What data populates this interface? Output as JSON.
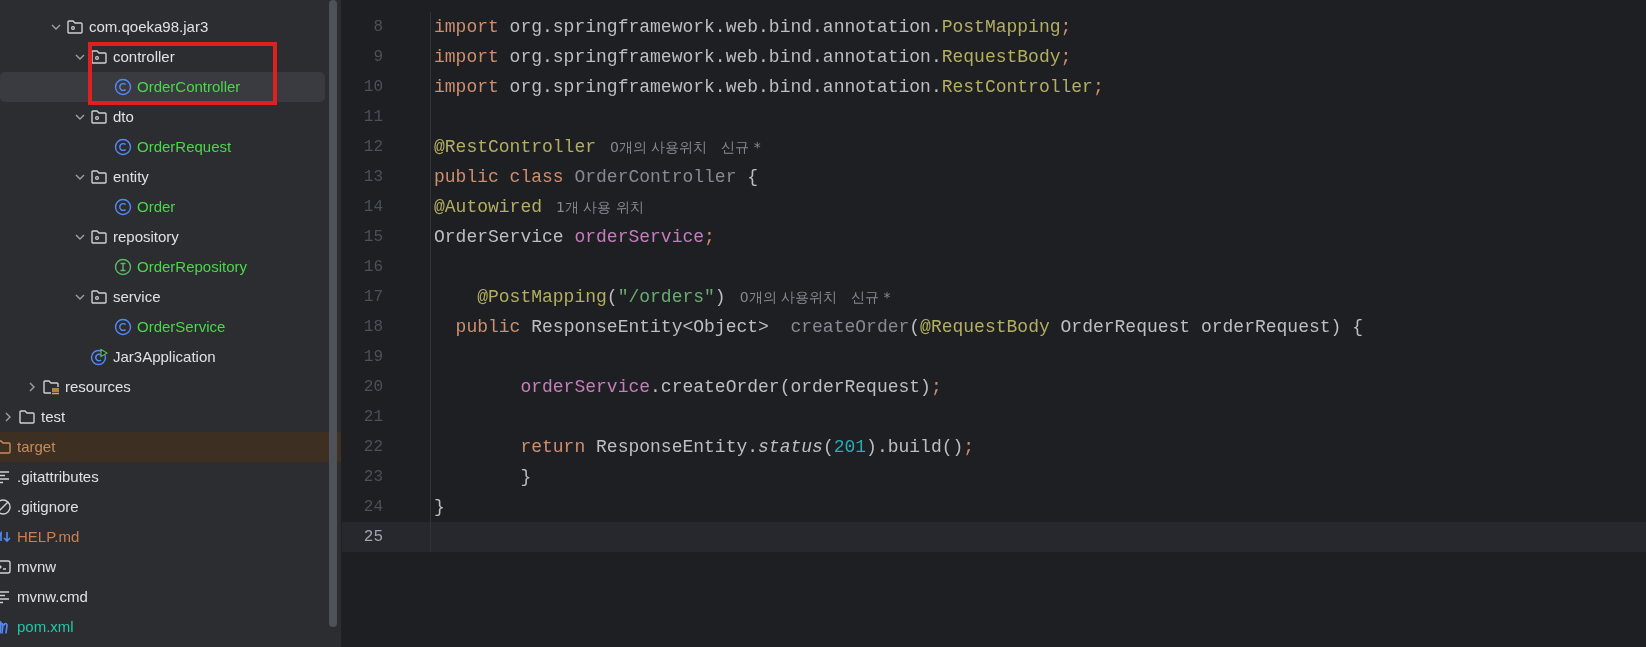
{
  "project_tree": {
    "items": [
      {
        "children": [
          {
            "children": [
              {
                "children": [
                  {
                    "label": "com.qoeka98.jar3",
                    "kind": "package",
                    "expanded": true,
                    "selected": false,
                    "excluded": false,
                    "color": "#dfe1e5",
                    "children": [
                      {
                        "label": "controller",
                        "kind": "package",
                        "expanded": true,
                        "selected": false,
                        "excluded": false,
                        "color": "#dfe1e5",
                        "children": [
                          {
                            "label": "OrderController",
                            "kind": "class",
                            "selected": true,
                            "excluded": false,
                            "color": "#4ad84a"
                          }
                        ]
                      },
                      {
                        "label": "dto",
                        "kind": "package",
                        "expanded": true,
                        "selected": false,
                        "excluded": false,
                        "color": "#dfe1e5",
                        "children": [
                          {
                            "label": "OrderRequest",
                            "kind": "class",
                            "selected": false,
                            "excluded": false,
                            "color": "#4ad84a"
                          }
                        ]
                      },
                      {
                        "label": "entity",
                        "kind": "package",
                        "expanded": true,
                        "selected": false,
                        "excluded": false,
                        "color": "#dfe1e5",
                        "children": [
                          {
                            "label": "Order",
                            "kind": "class",
                            "selected": false,
                            "excluded": false,
                            "color": "#4ad84a"
                          }
                        ]
                      },
                      {
                        "label": "repository",
                        "kind": "package",
                        "expanded": true,
                        "selected": false,
                        "excluded": false,
                        "color": "#dfe1e5",
                        "children": [
                          {
                            "label": "OrderRepository",
                            "kind": "interface",
                            "selected": false,
                            "excluded": false,
                            "color": "#4ad84a"
                          }
                        ]
                      },
                      {
                        "label": "service",
                        "kind": "package",
                        "expanded": true,
                        "selected": false,
                        "excluded": false,
                        "color": "#dfe1e5",
                        "children": [
                          {
                            "label": "OrderService",
                            "kind": "class",
                            "selected": false,
                            "excluded": false,
                            "color": "#4ad84a"
                          }
                        ]
                      },
                      {
                        "label": "Jar3Application",
                        "kind": "app-class",
                        "selected": false,
                        "excluded": false,
                        "color": "#dfe1e5"
                      }
                    ]
                  }
                ]
              },
              {
                "label": "resources",
                "kind": "resources-folder",
                "expanded": false,
                "selected": false,
                "excluded": false,
                "color": "#dfe1e5"
              }
            ]
          },
          {
            "label": "test",
            "kind": "folder",
            "expanded": false,
            "selected": false,
            "excluded": false,
            "color": "#dfe1e5"
          }
        ]
      },
      {
        "label": "target",
        "kind": "folder",
        "selected": false,
        "excluded": true,
        "color": "#c88a5c"
      },
      {
        "label": ".gitattributes",
        "kind": "text-file",
        "selected": false,
        "excluded": false,
        "color": "#dfe1e5"
      },
      {
        "label": ".gitignore",
        "kind": "ignore-file",
        "selected": false,
        "excluded": false,
        "color": "#dfe1e5"
      },
      {
        "label": "HELP.md",
        "kind": "markdown-file",
        "selected": false,
        "excluded": false,
        "color": "#cc7f4e"
      },
      {
        "label": "mvnw",
        "kind": "script-file",
        "selected": false,
        "excluded": false,
        "color": "#dfe1e5"
      },
      {
        "label": "mvnw.cmd",
        "kind": "text-file",
        "selected": false,
        "excluded": false,
        "color": "#dfe1e5"
      },
      {
        "label": "pom.xml",
        "kind": "maven-file",
        "selected": false,
        "excluded": false,
        "color": "#21c7a8"
      }
    ]
  },
  "editor": {
    "lines": [
      {
        "number": "8",
        "current": false,
        "tokens": [
          {
            "kind": "keyword",
            "text": "import"
          },
          {
            "kind": "plain",
            "text": " org.springframework.web.bind.annotation."
          },
          {
            "kind": "annotation",
            "text": "PostMapping"
          },
          {
            "kind": "punct",
            "text": ";"
          }
        ]
      },
      {
        "number": "9",
        "current": false,
        "tokens": [
          {
            "kind": "keyword",
            "text": "import"
          },
          {
            "kind": "plain",
            "text": " org.springframework.web.bind.annotation."
          },
          {
            "kind": "annotation",
            "text": "RequestBody"
          },
          {
            "kind": "punct",
            "text": ";"
          }
        ]
      },
      {
        "number": "10",
        "current": false,
        "tokens": [
          {
            "kind": "keyword",
            "text": "import"
          },
          {
            "kind": "plain",
            "text": " org.springframework.web.bind.annotation."
          },
          {
            "kind": "annotation",
            "text": "RestController"
          },
          {
            "kind": "punct",
            "text": ";"
          }
        ]
      },
      {
        "number": "11",
        "current": false
      },
      {
        "number": "12",
        "current": false,
        "tokens": [
          {
            "kind": "annotation",
            "text": "@RestController"
          }
        ],
        "hints": [
          "0개의 사용위치",
          "신규 *"
        ]
      },
      {
        "number": "13",
        "current": false,
        "tokens": [
          {
            "kind": "keyword",
            "text": "public class "
          },
          {
            "kind": "unused",
            "text": "OrderController"
          },
          {
            "kind": "plain",
            "text": " {"
          }
        ]
      },
      {
        "number": "14",
        "current": false,
        "tokens": [
          {
            "kind": "annotation",
            "text": "@Autowired"
          }
        ],
        "hints": [
          "1개 사용 위치"
        ]
      },
      {
        "number": "15",
        "current": false,
        "tokens": [
          {
            "kind": "plain",
            "text": "OrderService "
          },
          {
            "kind": "field",
            "text": "orderService"
          },
          {
            "kind": "punct",
            "text": ";"
          }
        ]
      },
      {
        "number": "16",
        "current": false
      },
      {
        "number": "17",
        "current": false,
        "tokens": [
          {
            "kind": "annotation",
            "text": "    @PostMapping"
          },
          {
            "kind": "plain",
            "text": "("
          },
          {
            "kind": "string",
            "text": "\"/orders\""
          },
          {
            "kind": "plain",
            "text": ")"
          }
        ],
        "hints": [
          "0개의 사용위치",
          "신규 *"
        ]
      },
      {
        "number": "18",
        "current": false,
        "tokens": [
          {
            "kind": "keyword",
            "text": "  public"
          },
          {
            "kind": "plain",
            "text": " ResponseEntity<Object>  "
          },
          {
            "kind": "unused",
            "text": "createOrder"
          },
          {
            "kind": "plain",
            "text": "("
          },
          {
            "kind": "annotation",
            "text": "@RequestBody"
          },
          {
            "kind": "plain",
            "text": " OrderRequest orderRequest) {"
          }
        ]
      },
      {
        "number": "19",
        "current": false
      },
      {
        "number": "20",
        "current": false,
        "tokens": [
          {
            "kind": "field",
            "text": "        orderService"
          },
          {
            "kind": "plain",
            "text": ".createOrder(orderRequest)"
          },
          {
            "kind": "punct",
            "text": ";"
          }
        ]
      },
      {
        "number": "21",
        "current": false
      },
      {
        "number": "22",
        "current": false,
        "tokens": [
          {
            "kind": "keyword",
            "text": "        return"
          },
          {
            "kind": "plain",
            "text": " ResponseEntity."
          },
          {
            "kind": "static",
            "text": "status"
          },
          {
            "kind": "plain",
            "text": "("
          },
          {
            "kind": "number",
            "text": "201"
          },
          {
            "kind": "plain",
            "text": ").build()"
          },
          {
            "kind": "punct",
            "text": ";"
          }
        ]
      },
      {
        "number": "23",
        "current": false,
        "tokens": [
          {
            "kind": "plain",
            "text": "        }"
          }
        ]
      },
      {
        "number": "24",
        "current": false,
        "tokens": [
          {
            "kind": "plain",
            "text": "}"
          }
        ]
      },
      {
        "number": "25",
        "current": true
      }
    ]
  }
}
